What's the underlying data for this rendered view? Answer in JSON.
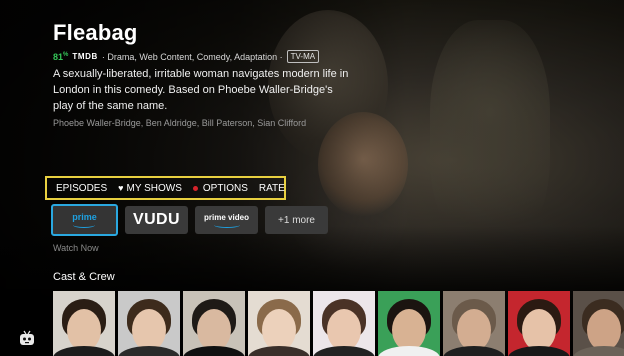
{
  "show": {
    "title": "Fleabag",
    "score": "81",
    "score_unit": "%",
    "score_source": "TMDB",
    "genres": "· Drama, Web Content, Comedy, Adaptation ·",
    "content_rating": "TV-MA",
    "description": "A sexually-liberated, irritable woman navigates modern life in London in this comedy. Based on Phoebe Waller-Bridge's play of the same name.",
    "cast_line": "Phoebe Waller-Bridge, Ben Aldridge, Bill Paterson, Sian Clifford"
  },
  "actions": {
    "episodes": "EPISODES",
    "my_shows": "MY SHOWS",
    "options": "OPTIONS",
    "rate": "RATE"
  },
  "providers": {
    "prime_label": "prime",
    "vudu_label": "VUDU",
    "prime_video_label": "prime video",
    "more_label": "+1 more",
    "watch_now": "Watch Now"
  },
  "cast_section": {
    "title": "Cast & Crew",
    "tiles": [
      {
        "name": "cast-member-1"
      },
      {
        "name": "cast-member-2"
      },
      {
        "name": "cast-member-3"
      },
      {
        "name": "cast-member-4"
      },
      {
        "name": "cast-member-5"
      },
      {
        "name": "cast-member-6"
      },
      {
        "name": "cast-member-7"
      },
      {
        "name": "cast-member-8"
      },
      {
        "name": "cast-member-9"
      }
    ]
  },
  "colors": {
    "focus_border": "#e8d040",
    "selected_provider_border": "#2aa8e0",
    "score_green": "#35c759",
    "options_dot": "#d6232b"
  },
  "icons": {
    "heart": "heart-icon",
    "options": "options-dot-icon",
    "app_logo": "tv-mascot-icon"
  }
}
